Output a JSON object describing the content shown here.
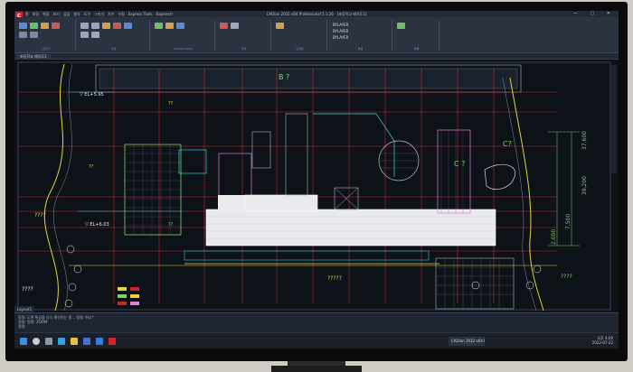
{
  "window": {
    "title": "CADian 2022 x64 Professional 5.1.26 - [초등학교 배치도1]",
    "app_logo": "C",
    "menus": [
      "홈",
      "파일",
      "편집",
      "보기",
      "삽입",
      "형식",
      "도구",
      "그리기",
      "치수",
      "수정",
      "Express Tools",
      "Expresstr"
    ],
    "controls": "— ▢ ✕"
  },
  "ribbon": {
    "groups": [
      "그리기",
      "수정",
      "Express Tools",
      "주석",
      "도면층",
      "블록",
      "특성",
      "그룹",
      "유틸리티",
      "뷰"
    ],
    "layer_values": [
      "BYLAYER",
      "BYLAYER",
      "BYLAYER"
    ]
  },
  "doc_tab": "초등학교 배치도1",
  "drawing": {
    "labels": {
      "b": "B ?",
      "c": "C ?",
      "c2": "C?",
      "el1": "▽ EL+5.95",
      "el2": "▽ EL+6.03",
      "q1": "????",
      "q2": "????",
      "q3": "?????",
      "q4": "????",
      "small1": "??",
      "small2": "??",
      "small3": "??",
      "dim1": "37,600",
      "dim2": "39,200",
      "dim3": "7,500",
      "dim4": "2,000"
    }
  },
  "layout_tab": "Layout1",
  "command": {
    "lines": [
      "명령: 도면 특성을 다시 계산하는 중... 명령: 취소*",
      "명령: 명령: ZOOM",
      "명령:"
    ]
  },
  "taskbar": {
    "active_task": "CADian 2022 x64 Professional",
    "time": "오후 4:00",
    "date": "2022-07-22"
  },
  "colors": {
    "accent": "#d6222b"
  },
  "icons": [
    "windows-start-icon",
    "search-icon",
    "task-view-icon",
    "edge-icon",
    "explorer-icon",
    "store-icon",
    "mail-icon",
    "cadian-icon"
  ]
}
